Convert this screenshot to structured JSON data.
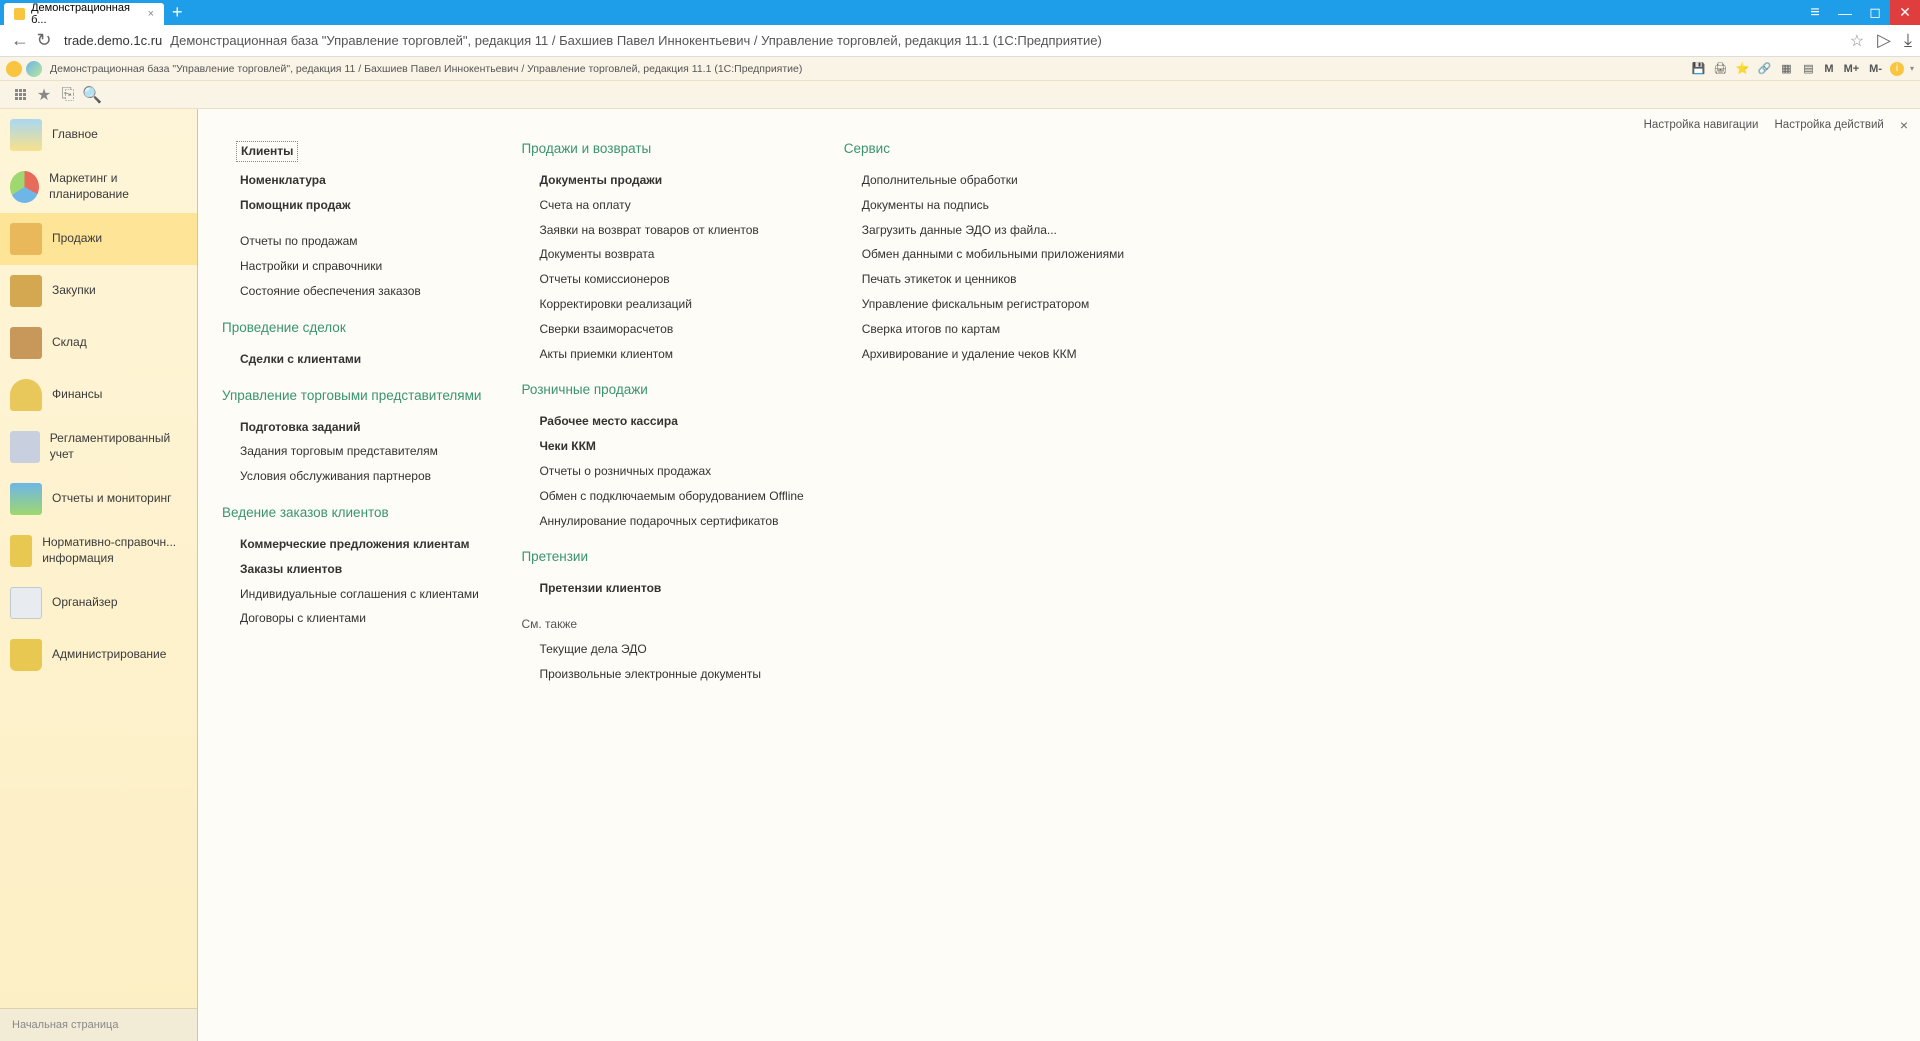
{
  "browser": {
    "tab_title": "Демонстрационная б...",
    "url_domain": "trade.demo.1c.ru",
    "url_title": "Демонстрационная база \"Управление торговлей\", редакция 11 / Бахшиев Павел Иннокентьевич / Управление торговлей, редакция 11.1 (1С:Предприятие)"
  },
  "app_bar": {
    "title": "Демонстрационная база \"Управление торговлей\", редакция 11 / Бахшиев Павел Иннокентьевич / Управление торговлей, редакция 11.1 (1С:Предприятие)",
    "m": "M",
    "m_plus": "M+",
    "m_minus": "M-"
  },
  "sidebar": {
    "items": [
      {
        "label": "Главное"
      },
      {
        "label": "Маркетинг и планирование"
      },
      {
        "label": "Продажи"
      },
      {
        "label": "Закупки"
      },
      {
        "label": "Склад"
      },
      {
        "label": "Финансы"
      },
      {
        "label": "Регламентированный учет"
      },
      {
        "label": "Отчеты и мониторинг"
      },
      {
        "label": "Нормативно-справочн... информация"
      },
      {
        "label": "Органайзер"
      },
      {
        "label": "Администрирование"
      }
    ],
    "footer": "Начальная страница"
  },
  "content_settings": {
    "nav": "Настройка навигации",
    "actions": "Настройка действий"
  },
  "col1": {
    "top": {
      "klienti": "Клиенты",
      "nomen": "Номенклатура",
      "pomosh": "Помощник продаж",
      "otchety": "Отчеты по продажам",
      "nastroiki": "Настройки и справочники",
      "sostoyanie": "Состояние обеспечения заказов"
    },
    "deals_header": "Проведение сделок",
    "deals": {
      "sdelki": "Сделки с клиентами"
    },
    "reps_header": "Управление торговыми представителями",
    "reps": {
      "podgotovka": "Подготовка заданий",
      "zadaniya": "Задания торговым представителям",
      "usloviya": "Условия обслуживания партнеров"
    },
    "orders_header": "Ведение заказов клиентов",
    "orders": {
      "komm": "Коммерческие предложения клиентам",
      "zakazy": "Заказы клиентов",
      "indiv": "Индивидуальные соглашения с клиентами",
      "dogovory": "Договоры с клиентами"
    }
  },
  "col2": {
    "sales_header": "Продажи и возвраты",
    "sales": {
      "docs": "Документы продажи",
      "scheta": "Счета на оплату",
      "zayavki": "Заявки на возврат товаров от клиентов",
      "docvoz": "Документы возврата",
      "otchkom": "Отчеты комиссионеров",
      "korr": "Корректировки реализаций",
      "sverki": "Сверки взаиморасчетов",
      "akty": "Акты приемки клиентом"
    },
    "retail_header": "Розничные продажи",
    "retail": {
      "kassir": "Рабочее место кассира",
      "cheki": "Чеки ККМ",
      "otch": "Отчеты о розничных продажах",
      "obmen": "Обмен с подключаемым оборудованием Offline",
      "annul": "Аннулирование подарочных сертификатов"
    },
    "claims_header": "Претензии",
    "claims": {
      "pret": "Претензии клиентов"
    },
    "see_also_header": "См. также",
    "see_also": {
      "tek": "Текущие дела ЭДО",
      "proizv": "Произвольные электронные документы"
    }
  },
  "col3": {
    "service_header": "Сервис",
    "service": {
      "dop": "Дополнительные обработки",
      "docpod": "Документы на подпись",
      "zagr": "Загрузить данные ЭДО из файла...",
      "obmen": "Обмен данными с мобильными приложениями",
      "pechat": "Печать этикеток и ценников",
      "upr": "Управление фискальным регистратором",
      "sverka": "Сверка итогов по картам",
      "arh": "Архивирование и удаление чеков ККМ"
    }
  }
}
